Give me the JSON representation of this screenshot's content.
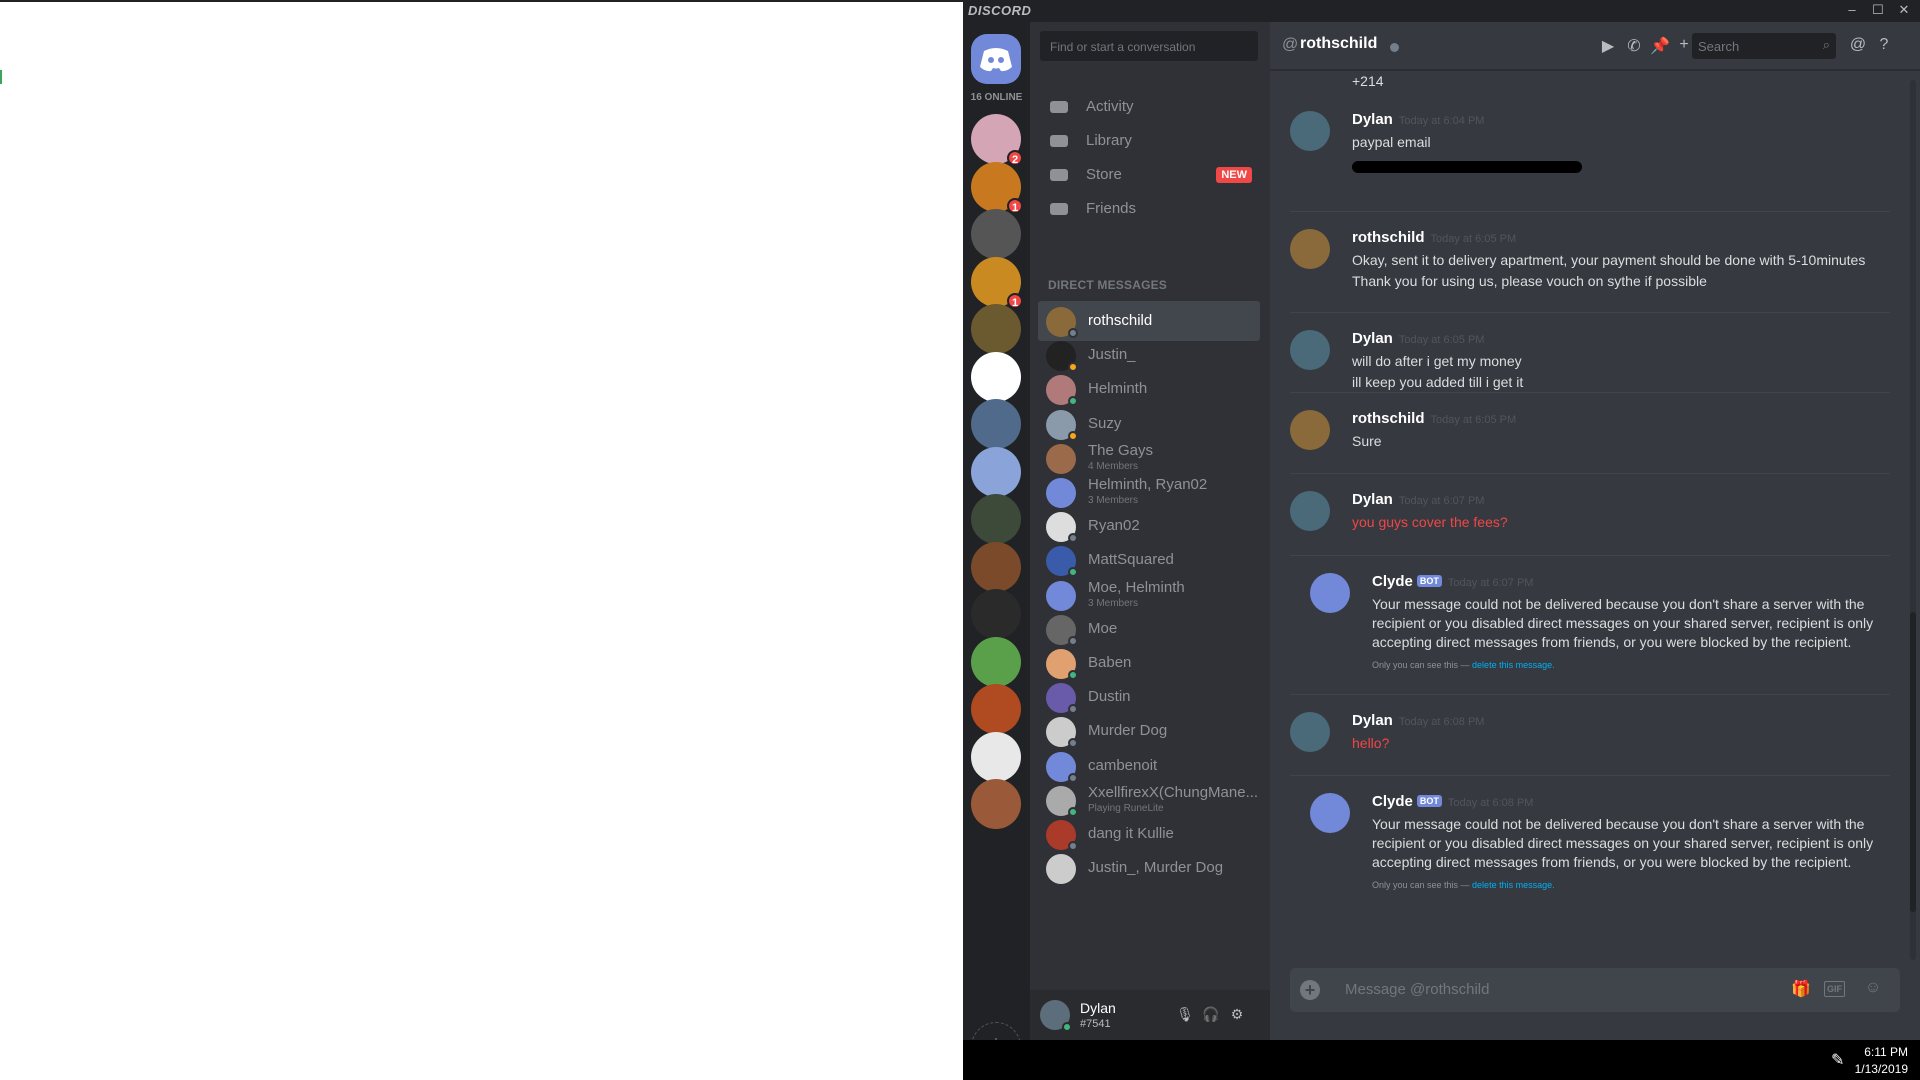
{
  "app": {
    "title": "DISCORD",
    "online_count": "16 ONLINE"
  },
  "guilds": [
    {
      "color": "#d4a5b5",
      "badge": "2"
    },
    {
      "color": "#c8781e",
      "badge": "1"
    },
    {
      "color": "#555555",
      "badge": ""
    },
    {
      "color": "#c98a22",
      "badge": "1"
    },
    {
      "color": "#6b5a30",
      "badge": ""
    },
    {
      "color": "#ffffff",
      "badge": ""
    },
    {
      "color": "#4f6a8a",
      "badge": ""
    },
    {
      "color": "#8aa3d8",
      "badge": ""
    },
    {
      "color": "#3d4a3a",
      "badge": ""
    },
    {
      "color": "#7a4a2a",
      "badge": ""
    },
    {
      "color": "#2a2a2a",
      "badge": ""
    },
    {
      "color": "#5aa04a",
      "badge": ""
    },
    {
      "color": "#b04a20",
      "badge": ""
    },
    {
      "color": "#e8e8e8",
      "badge": ""
    },
    {
      "color": "#9a5a3a",
      "badge": ""
    }
  ],
  "sidebar": {
    "search_placeholder": "Find or start a conversation",
    "nav": [
      {
        "label": "Activity",
        "icon": "controller-icon"
      },
      {
        "label": "Library",
        "icon": "library-icon"
      },
      {
        "label": "Store",
        "icon": "store-icon",
        "badge": "NEW"
      },
      {
        "label": "Friends",
        "icon": "friends-icon"
      }
    ],
    "dm_header": "DIRECT MESSAGES",
    "dms": [
      {
        "name": "rothschild",
        "sub": "",
        "color": "#8a6a3a",
        "status": "#747f8d"
      },
      {
        "name": "Justin_",
        "sub": "",
        "color": "#222222",
        "status": "#faa61a"
      },
      {
        "name": "Helminth",
        "sub": "",
        "color": "#b07a7a",
        "status": "#43b581"
      },
      {
        "name": "Suzy",
        "sub": "",
        "color": "#8a9aaa",
        "status": "#faa61a"
      },
      {
        "name": "The Gays",
        "sub": "4 Members",
        "color": "#9a6a4a",
        "status": ""
      },
      {
        "name": "Helminth, Ryan02",
        "sub": "3 Members",
        "color": "#7289da",
        "status": ""
      },
      {
        "name": "Ryan02",
        "sub": "",
        "color": "#dddddd",
        "status": "#747f8d"
      },
      {
        "name": "MattSquared",
        "sub": "",
        "color": "#3a5aaa",
        "status": "#43b581"
      },
      {
        "name": "Moe, Helminth",
        "sub": "3 Members",
        "color": "#7289da",
        "status": ""
      },
      {
        "name": "Moe",
        "sub": "",
        "color": "#666666",
        "status": "#747f8d"
      },
      {
        "name": "Baben",
        "sub": "",
        "color": "#e0a070",
        "status": "#43b581"
      },
      {
        "name": "Dustin",
        "sub": "",
        "color": "#6a5aaa",
        "status": "#747f8d"
      },
      {
        "name": "Murder Dog",
        "sub": "",
        "color": "#cccccc",
        "status": "#747f8d"
      },
      {
        "name": "cambenoit",
        "sub": "",
        "color": "#7289da",
        "status": "#747f8d"
      },
      {
        "name": "XxellfirexX(ChungMane...",
        "sub": "Playing RuneLite",
        "color": "#aaaaaa",
        "status": "#43b581"
      },
      {
        "name": "dang it Kullie",
        "sub": "",
        "color": "#aa3a2a",
        "status": "#747f8d"
      },
      {
        "name": "Justin_, Murder Dog",
        "sub": "",
        "color": "#cccccc",
        "status": ""
      }
    ]
  },
  "user": {
    "name": "Dylan",
    "tag": "#7541"
  },
  "chat": {
    "at": "@",
    "title": "rothschild",
    "search_placeholder": "Search",
    "top_fragment": "+214",
    "messages": [
      {
        "author": "Dylan",
        "time": "Today at 6:04 PM",
        "bot": "",
        "color": "#4a6a7a",
        "lines": [
          "paypal email"
        ],
        "red": false,
        "note": ""
      },
      {
        "author": "rothschild",
        "time": "Today at 6:05 PM",
        "bot": "",
        "color": "#8a6a3a",
        "lines": [
          "Okay, sent it to delivery apartment, your payment should be done with 5-10minutes",
          "Thank you for using us, please vouch on sythe if possible"
        ],
        "red": false,
        "note": ""
      },
      {
        "author": "Dylan",
        "time": "Today at 6:05 PM",
        "bot": "",
        "color": "#4a6a7a",
        "lines": [
          "will do after i get my money",
          "ill keep you added till i get it"
        ],
        "red": false,
        "note": ""
      },
      {
        "author": "rothschild",
        "time": "Today at 6:05 PM",
        "bot": "",
        "color": "#8a6a3a",
        "lines": [
          "Sure"
        ],
        "red": false,
        "note": ""
      },
      {
        "author": "Dylan",
        "time": "Today at 6:07 PM",
        "bot": "",
        "color": "#4a6a7a",
        "lines": [
          "you guys cover the fees?"
        ],
        "red": true,
        "note": ""
      },
      {
        "author": "Clyde",
        "time": "Today at 6:07 PM",
        "bot": "BOT",
        "color": "#7289da",
        "lines": [
          "Your message could not be delivered because you don't share a server with the recipient or you disabled direct messages on your shared server, recipient is only accepting direct messages from friends, or you were blocked by the recipient."
        ],
        "red": false,
        "note": "Only you can see this — ",
        "note_link": "delete this message."
      },
      {
        "author": "Dylan",
        "time": "Today at 6:08 PM",
        "bot": "",
        "color": "#4a6a7a",
        "lines": [
          "hello?"
        ],
        "red": true,
        "note": ""
      },
      {
        "author": "Clyde",
        "time": "Today at 6:08 PM",
        "bot": "BOT",
        "color": "#7289da",
        "lines": [
          "Your message could not be delivered because you don't share a server with the recipient or you disabled direct messages on your shared server, recipient is only accepting direct messages from friends, or you were blocked by the recipient."
        ],
        "red": false,
        "note": "Only you can see this — ",
        "note_link": "delete this message."
      }
    ],
    "composer_placeholder": "Message @rothschild",
    "gif_label": "GIF"
  },
  "taskbar": {
    "time": "6:11 PM",
    "date": "1/13/2019"
  }
}
